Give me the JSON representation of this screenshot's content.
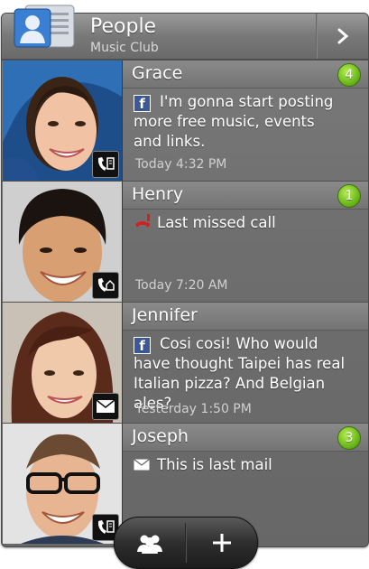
{
  "header": {
    "title": "People",
    "subtitle": "Music Club"
  },
  "contacts": [
    {
      "name": "Grace",
      "badge": "4",
      "message_source": "facebook",
      "message": "I'm gonna start posting more free music, events and links.",
      "time": "Today  4:32 PM",
      "contact_type": "phone-book"
    },
    {
      "name": "Henry",
      "badge": "1",
      "message_source": "missed-call",
      "message": "Last missed call",
      "time": "Today  7:20 AM",
      "contact_type": "phone-home"
    },
    {
      "name": "Jennifer",
      "badge": "",
      "message_source": "facebook",
      "message": "Cosi cosi! Who would have thought Taipei has real Italian pizza? And Belgian ales?",
      "time": "Yesterday  1:50 PM",
      "contact_type": "mail"
    },
    {
      "name": "Joseph",
      "badge": "3",
      "message_source": "mail",
      "message": "This is last mail",
      "time": "",
      "contact_type": "phone-book"
    }
  ],
  "colors": {
    "badge_green": "#6cb81c",
    "facebook_blue": "#3b5998",
    "panel_gray": "#727272"
  }
}
